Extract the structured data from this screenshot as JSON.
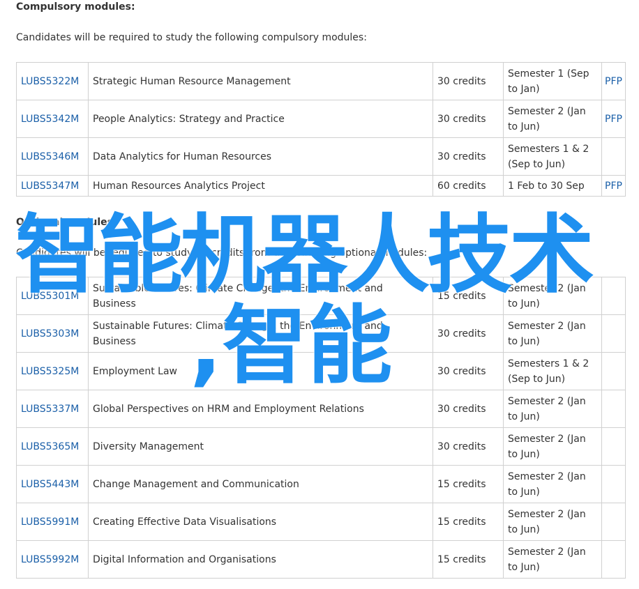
{
  "compulsory": {
    "heading": "Compulsory modules:",
    "intro": "Candidates will be required to study the following compulsory modules:",
    "modules": [
      {
        "code": "LUBS5322M",
        "title": "Strategic Human Resource Management",
        "credits": "30 credits",
        "semester": "Semester 1 (Sep to Jan)",
        "pfp": "PFP"
      },
      {
        "code": "LUBS5342M",
        "title": "People Analytics: Strategy and Practice",
        "credits": "30 credits",
        "semester": "Semester 2 (Jan to Jun)",
        "pfp": "PFP"
      },
      {
        "code": "LUBS5346M",
        "title": "Data Analytics for Human Resources",
        "credits": "30 credits",
        "semester": "Semesters 1 & 2 (Sep to Jun)",
        "pfp": ""
      },
      {
        "code": "LUBS5347M",
        "title": "Human Resources Analytics Project",
        "credits": "60 credits",
        "semester": "1 Feb to 30 Sep",
        "pfp": "PFP"
      }
    ]
  },
  "optional": {
    "heading": "Optional modules:",
    "intro": "Candidates will be required to study 30 credits from the following optional modules:",
    "modules": [
      {
        "code": "LUBS5301M",
        "title": "Sustainable Futures: Climate Change, the Environment and Business",
        "credits": "15 credits",
        "semester": "Semester 2 (Jan to Jun)",
        "pfp": ""
      },
      {
        "code": "LUBS5303M",
        "title": "Sustainable Futures: Climate Change, the Environment and Business",
        "credits": "30 credits",
        "semester": "Semester 2 (Jan to Jun)",
        "pfp": ""
      },
      {
        "code": "LUBS5325M",
        "title": "Employment Law",
        "credits": "30 credits",
        "semester": "Semesters 1 & 2 (Sep to Jun)",
        "pfp": ""
      },
      {
        "code": "LUBS5337M",
        "title": "Global Perspectives on HRM and Employment Relations",
        "credits": "30 credits",
        "semester": "Semester 2 (Jan to Jun)",
        "pfp": ""
      },
      {
        "code": "LUBS5365M",
        "title": "Diversity Management",
        "credits": "30 credits",
        "semester": "Semester 2 (Jan to Jun)",
        "pfp": ""
      },
      {
        "code": "LUBS5443M",
        "title": "Change Management and Communication",
        "credits": "15 credits",
        "semester": "Semester 2 (Jan to Jun)",
        "pfp": ""
      },
      {
        "code": "LUBS5991M",
        "title": "Creating Effective Data Visualisations",
        "credits": "15 credits",
        "semester": "Semester 2 (Jan to Jun)",
        "pfp": ""
      },
      {
        "code": "LUBS5992M",
        "title": "Digital Information and Organisations",
        "credits": "15 credits",
        "semester": "Semester 2 (Jan to Jun)",
        "pfp": ""
      }
    ]
  },
  "overlay": {
    "line1": "智能机器人技术",
    "line2": ",智能",
    "color": "#1e90f0"
  },
  "colors": {
    "link": "#1a5fa8",
    "border": "#d0d0d0",
    "text": "#333333"
  }
}
